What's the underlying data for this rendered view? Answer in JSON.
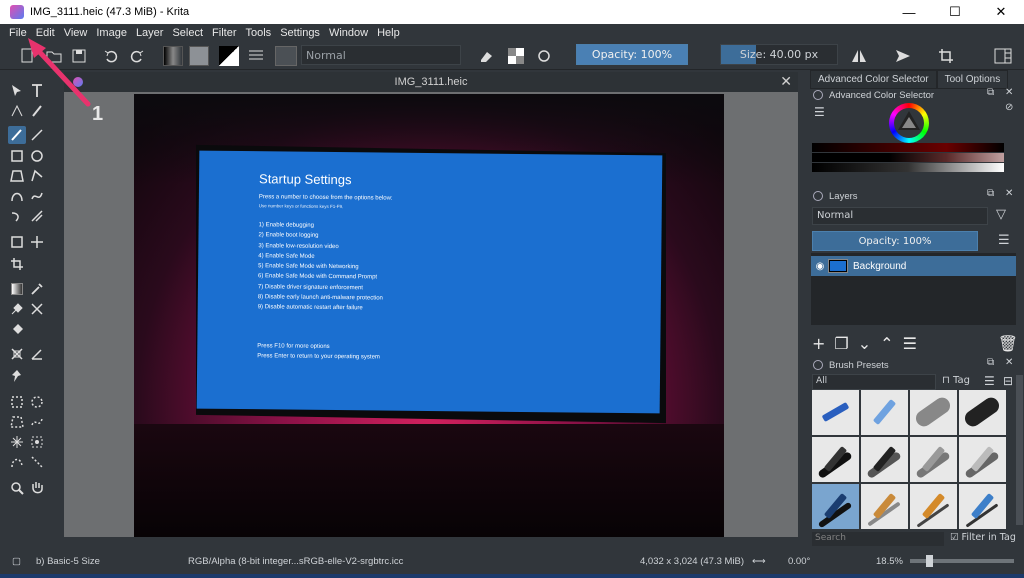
{
  "window": {
    "title": "IMG_3111.heic (47.3 MiB)  - Krita",
    "minimize": "—",
    "maximize": "☐",
    "close": "✕"
  },
  "menu": [
    "File",
    "Edit",
    "View",
    "Image",
    "Layer",
    "Select",
    "Filter",
    "Tools",
    "Settings",
    "Window",
    "Help"
  ],
  "toolbar": {
    "blend_mode": "Normal",
    "opacity_label": "Opacity: 100%",
    "opacity_value": 1.0,
    "size_label": "Size: 40.00 px",
    "size_fill": 0.3
  },
  "document": {
    "tab_title": "IMG_3111.heic",
    "close": "✕"
  },
  "photo_screen": {
    "title": "Startup Settings",
    "subtitle": "Press a number to choose from the options below:",
    "hint": "Use number keys or functions keys F1-F9.",
    "options": [
      "1) Enable debugging",
      "2) Enable boot logging",
      "3) Enable low-resolution video",
      "4) Enable Safe Mode",
      "5) Enable Safe Mode with Networking",
      "6) Enable Safe Mode with Command Prompt",
      "7) Disable driver signature enforcement",
      "8) Disable early launch anti-malware protection",
      "9) Disable automatic restart after failure"
    ],
    "footer1": "Press F10 for more options",
    "footer2": "Press Enter to return to your operating system"
  },
  "annotation": {
    "label": "1",
    "color": "#e8336d"
  },
  "right_tabs": [
    "Advanced Color Selector",
    "Tool Options"
  ],
  "color_selector": {
    "title": "Advanced Color Selector"
  },
  "layers": {
    "title": "Layers",
    "blend_mode": "Normal",
    "opacity_label": "Opacity:  100%",
    "items": [
      {
        "name": "Background"
      }
    ]
  },
  "brush_presets": {
    "title": "Brush Presets",
    "filter": "All",
    "tag_label": "Tag",
    "search_placeholder": "Search",
    "filter_in_tag": "Filter in Tag"
  },
  "status": {
    "brush": "b) Basic-5 Size",
    "color_space": "RGB/Alpha (8-bit integer...sRGB-elle-V2-srgbtrc.icc",
    "dimensions": "4,032 x 3,024 (47.3 MiB)",
    "rotation": "0.00°",
    "zoom": "18.5%"
  },
  "colors": {
    "accent": "#3d6d99",
    "background": "#31363b",
    "windows_screen": "#1b6fd0"
  }
}
